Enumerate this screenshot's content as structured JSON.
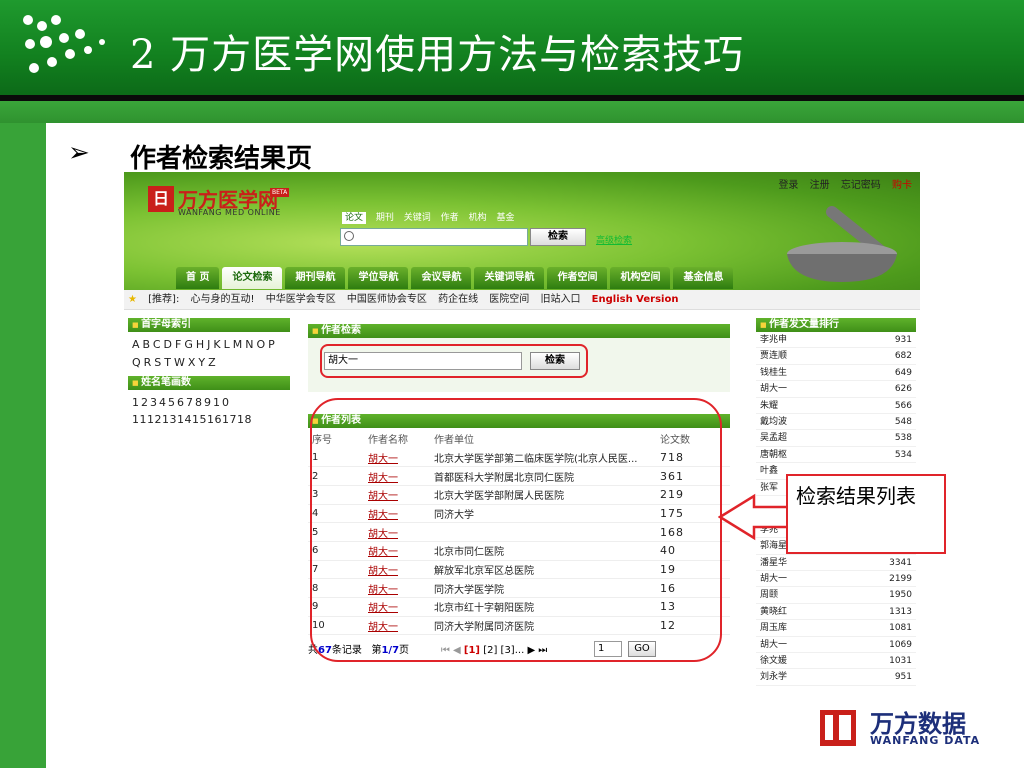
{
  "slide": {
    "title": "2 万方医学网使用方法与检索技巧",
    "url": "http://med.wanfangdata.com.cn",
    "bullet": "➢",
    "subtitle": "作者检索结果页",
    "callout": "检索结果列表",
    "brand_cn": "万方数据",
    "brand_en": "WANFANG DATA",
    "colors": {
      "header_green": "#12801f",
      "accent_red": "#e0242a",
      "brand_blue": "#1d2f7a"
    }
  },
  "site": {
    "top_links": [
      "登录",
      "注册",
      "忘记密码",
      "购卡"
    ],
    "logo_mark": "日",
    "logo_text": "万方医学网",
    "logo_sub": "WANFANG MED ONLINE",
    "beta": "BETA",
    "search_tabs": [
      "论文",
      "期刊",
      "关键词",
      "作者",
      "机构",
      "基金"
    ],
    "search_button": "检索",
    "advanced_link": "高级检索",
    "nav": [
      "首 页",
      "论文检索",
      "期刊导航",
      "学位导航",
      "会议导航",
      "关键词导航",
      "作者空间",
      "机构空间",
      "基金信息"
    ],
    "recommend": [
      "[推荐]:",
      "心与身的互动!",
      "中华医学会专区",
      "中国医师协会专区",
      "药企在线",
      "医院空间",
      "旧站入口"
    ],
    "english": "English Version"
  },
  "left": {
    "index_title": "首字母索引",
    "letters": "ABCDFGHJKLMNOPQRSTWXYZ",
    "stroke_title": "姓名笔画数",
    "strokes": "12345678910",
    "strokes2": "1112131415161718"
  },
  "author_search": {
    "title": "作者检索",
    "input_value": "胡大一",
    "button": "检索"
  },
  "author_list": {
    "title": "作者列表",
    "headers": [
      "序号",
      "作者名称",
      "作者单位",
      "论文数"
    ],
    "rows": [
      [
        "1",
        "胡大一",
        "北京大学医学部第二临床医学院(北京人民医...",
        "718"
      ],
      [
        "2",
        "胡大一",
        "首都医科大学附属北京同仁医院",
        "361"
      ],
      [
        "3",
        "胡大一",
        "北京大学医学部附属人民医院",
        "219"
      ],
      [
        "4",
        "胡大一",
        "同济大学",
        "175"
      ],
      [
        "5",
        "胡大一",
        "",
        "168"
      ],
      [
        "6",
        "胡大一",
        "北京市同仁医院",
        "40"
      ],
      [
        "7",
        "胡大一",
        "解放军北京军区总医院",
        "19"
      ],
      [
        "8",
        "胡大一",
        "同济大学医学院",
        "16"
      ],
      [
        "9",
        "胡大一",
        "北京市红十字朝阳医院",
        "13"
      ],
      [
        "10",
        "胡大一",
        "同济大学附属同济医院",
        "12"
      ]
    ],
    "pager": {
      "total_prefix": "共",
      "total": "67",
      "total_suffix": "条记录",
      "page_prefix": "第",
      "page": "1/7",
      "page_suffix": "页",
      "first": "⏮ ◀",
      "current": "[1]",
      "others": "[2] [3]...",
      "next": "▶ ⏭",
      "input": "1",
      "go": "GO"
    }
  },
  "ranking": {
    "title": "作者发文量排行",
    "rows": [
      [
        "李兆申",
        "931"
      ],
      [
        "贾连顺",
        "682"
      ],
      [
        "钱桂生",
        "649"
      ],
      [
        "胡大一",
        "626"
      ],
      [
        "朱耀",
        "566"
      ],
      [
        "戴均波",
        "548"
      ],
      [
        "吴孟超",
        "538"
      ],
      [
        "唐朝枢",
        "534"
      ],
      [
        "叶鑫",
        ""
      ],
      [
        "张军",
        ""
      ]
    ],
    "title2": "作",
    "rows2": [
      [
        "李兆",
        ""
      ],
      [
        "郭海星",
        "3966"
      ],
      [
        "潘星华",
        "3341"
      ],
      [
        "胡大一",
        "2199"
      ],
      [
        "周颐",
        "1950"
      ],
      [
        "黄晓红",
        "1313"
      ],
      [
        "周玉库",
        "1081"
      ],
      [
        "胡大一",
        "1069"
      ],
      [
        "徐文媛",
        "1031"
      ],
      [
        "刘永学",
        "951"
      ]
    ]
  }
}
